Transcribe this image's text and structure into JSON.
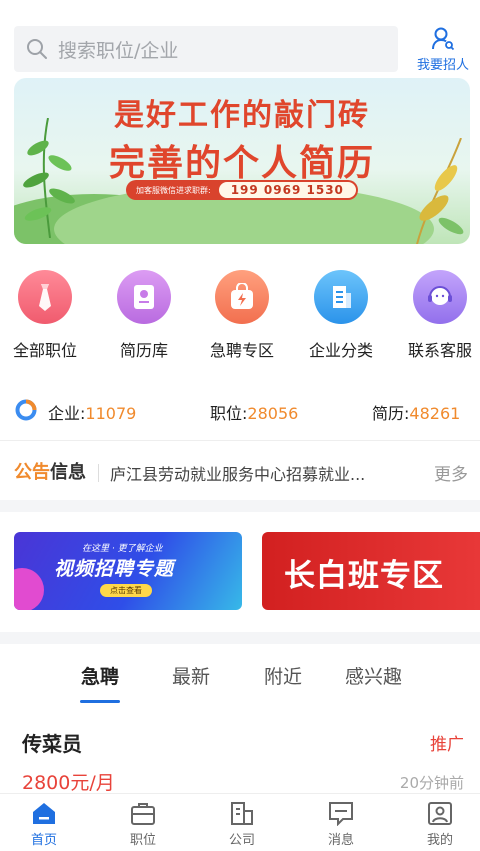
{
  "search": {
    "placeholder": "搜索职位/企业"
  },
  "header": {
    "recruit_label": "我要招人"
  },
  "banner": {
    "line1": "是好工作的敲门砖",
    "line2": "完善的个人简历",
    "wechat_label": "加客服微信进求职群:",
    "wechat_number": "199 0969 1530"
  },
  "categories": [
    {
      "label": "全部职位",
      "icon": "tie-icon",
      "color": "#f46b7c"
    },
    {
      "label": "简历库",
      "icon": "resume-book-icon",
      "color": "#c77be8"
    },
    {
      "label": "急聘专区",
      "icon": "urgent-bag-icon",
      "color": "#f7805f"
    },
    {
      "label": "企业分类",
      "icon": "building-icon",
      "color": "#3aa6f0"
    },
    {
      "label": "联系客服",
      "icon": "customer-service-icon",
      "color": "#a57ff0"
    }
  ],
  "stats": {
    "company_label": "企业:",
    "company_value": "11079",
    "job_label": "职位:",
    "job_value": "28056",
    "resume_label": "简历:",
    "resume_value": "48261"
  },
  "notice": {
    "tag_a": "公告",
    "tag_b": "信息",
    "text": "庐江县劳动就业服务中心招募就业...",
    "more": "更多"
  },
  "promos": {
    "video": {
      "small": "在这里 · 更了解企业",
      "title": "视频招聘专题",
      "button": "点击查看"
    },
    "changbai": {
      "title": "长白班专区"
    }
  },
  "tabs": [
    {
      "label": "急聘",
      "active": true
    },
    {
      "label": "最新",
      "active": false
    },
    {
      "label": "附近",
      "active": false
    },
    {
      "label": "感兴趣",
      "active": false
    }
  ],
  "job": {
    "title": "传菜员",
    "badge": "推广",
    "salary": "2800元/月",
    "time": "20分钟前"
  },
  "nav": [
    {
      "label": "首页",
      "icon": "home-icon",
      "active": true
    },
    {
      "label": "职位",
      "icon": "briefcase-icon",
      "active": false
    },
    {
      "label": "公司",
      "icon": "company-icon",
      "active": false
    },
    {
      "label": "消息",
      "icon": "message-icon",
      "active": false
    },
    {
      "label": "我的",
      "icon": "profile-icon",
      "active": false
    }
  ],
  "colors": {
    "accent": "#1f6fe0",
    "orange": "#f08a2d",
    "red": "#e8433a"
  }
}
